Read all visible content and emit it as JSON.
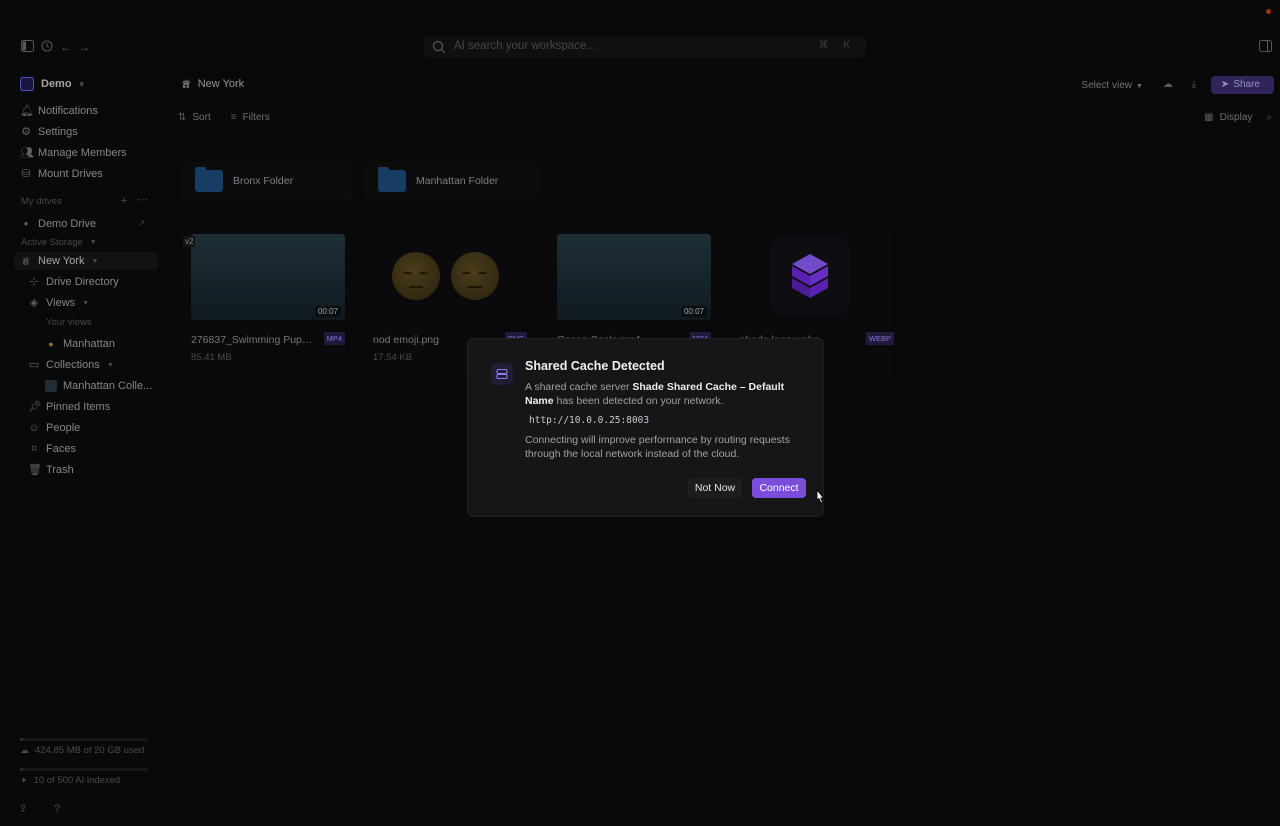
{
  "search": {
    "placeholder": "AI search your workspace...",
    "shortcut": "⌘ K"
  },
  "sidebar": {
    "workspace": "Demo",
    "nav": [
      "Notifications",
      "Settings",
      "Manage Members",
      "Mount Drives"
    ],
    "my_drives_label": "My drives",
    "drive": "Demo Drive",
    "active_storage_label": "Active Storage",
    "current_location": "New York",
    "tree": {
      "drive_directory": "Drive Directory",
      "views": "Views",
      "your_views": "Your views",
      "view_manhattan": "Manhattan",
      "collections": "Collections",
      "collection_manhattan": "Manhattan Colle...",
      "pinned": "Pinned Items",
      "people": "People",
      "faces": "Faces",
      "trash": "Trash"
    },
    "storage_used": "424.85 MB of 20 GB used",
    "storage_fraction": 0.021,
    "ai_indexed": "10 of 500 AI indexed",
    "ai_fraction": 0.02
  },
  "main": {
    "breadcrumb": "New York",
    "select_view": "Select view",
    "share": "Share",
    "sort": "Sort",
    "filters": "Filters",
    "display": "Display",
    "folders": [
      "Bronx Folder",
      "Manhattan Folder"
    ],
    "files": [
      {
        "name": "276837_Swimming Pups ...",
        "size": "85.41 MB",
        "type": "MP4",
        "duration": "00:07",
        "version": "v2"
      },
      {
        "name": "nod emoji.png",
        "size": "17.54 KB",
        "type": "PNG"
      },
      {
        "name": "Ocean Seals.mp4",
        "type": "MP4",
        "duration": "00:07"
      },
      {
        "name": "shade logo.webp",
        "type": "WEBP"
      }
    ]
  },
  "dialog": {
    "title": "Shared Cache Detected",
    "body_prefix": "A shared cache server ",
    "server_name": "Shade Shared Cache – Default Name",
    "body_suffix": " has been detected on your network.",
    "address": "http://10.0.0.25:8003",
    "body2": "Connecting will improve performance by routing requests through the local network instead of the cloud.",
    "not_now": "Not Now",
    "connect": "Connect"
  },
  "colors": {
    "accent": "#7c4ddb",
    "folder": "#1e4b7a",
    "tag_text": "#a78bfa"
  }
}
